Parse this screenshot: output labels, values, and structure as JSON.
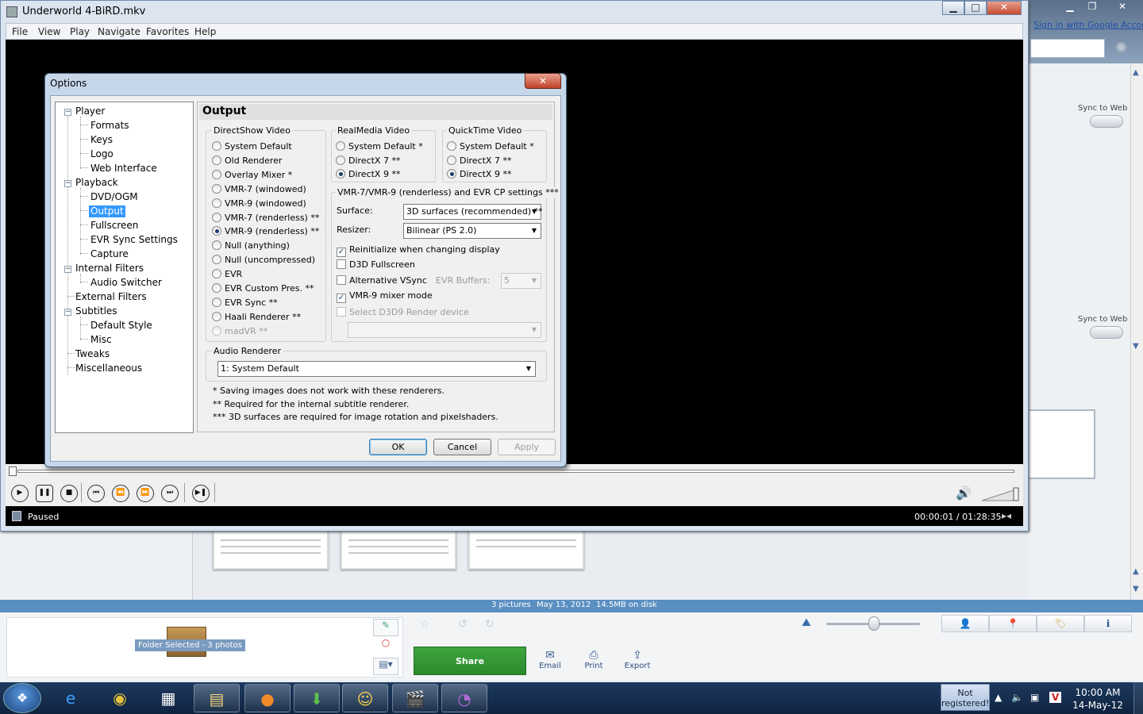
{
  "picasa": {
    "sign_in": "Sign in with Google Account",
    "sync_label": "Sync to Web",
    "info": {
      "pictures": "3 pictures",
      "date": "May 13, 2012",
      "size": "14.5MB on disk"
    },
    "folder_label": "Folder Selected - 3 photos",
    "share": "Share",
    "actions": {
      "email": "Email",
      "print": "Print",
      "export": "Export"
    }
  },
  "mpc": {
    "title": "Underworld 4-BiRD.mkv",
    "menu": [
      "File",
      "View",
      "Play",
      "Navigate",
      "Favorites",
      "Help"
    ],
    "status": "Paused",
    "time": "00:00:01 / 01:28:35"
  },
  "dialog": {
    "title": "Options",
    "panel_title": "Output",
    "tree": [
      {
        "label": "Player",
        "children": [
          "Formats",
          "Keys",
          "Logo",
          "Web Interface"
        ]
      },
      {
        "label": "Playback",
        "children": [
          "DVD/OGM",
          "Output",
          "Fullscreen",
          "EVR Sync Settings",
          "Capture"
        ]
      },
      {
        "label": "Internal Filters",
        "children": [
          "Audio Switcher"
        ]
      },
      {
        "label": "External Filters",
        "children": []
      },
      {
        "label": "Subtitles",
        "children": [
          "Default Style",
          "Misc"
        ]
      },
      {
        "label": "Tweaks",
        "children": []
      },
      {
        "label": "Miscellaneous",
        "children": []
      }
    ],
    "selected": "Output",
    "directshow": {
      "label": "DirectShow Video",
      "options": [
        "System Default",
        "Old Renderer",
        "Overlay Mixer *",
        "VMR-7 (windowed)",
        "VMR-9 (windowed)",
        "VMR-7 (renderless) **",
        "VMR-9 (renderless) **",
        "Null (anything)",
        "Null (uncompressed)",
        "EVR",
        "EVR Custom Pres. **",
        "EVR Sync **",
        "Haali Renderer **",
        "madVR **"
      ],
      "selected": "VMR-9 (renderless) **"
    },
    "realmedia": {
      "label": "RealMedia Video",
      "options": [
        "System Default *",
        "DirectX 7 **",
        "DirectX 9 **"
      ],
      "selected": "DirectX 9 **"
    },
    "quicktime": {
      "label": "QuickTime Video",
      "options": [
        "System Default *",
        "DirectX 7 **",
        "DirectX 9 **"
      ],
      "selected": "DirectX 9 **"
    },
    "vmr": {
      "label": "VMR-7/VMR-9 (renderless) and EVR CP settings ***",
      "surface_label": "Surface:",
      "surface_value": "3D surfaces (recommended) **",
      "resizer_label": "Resizer:",
      "resizer_value": "Bilinear (PS 2.0)",
      "reinit": "Reinitialize when changing display",
      "d3d": "D3D Fullscreen",
      "altvsync": "Alternative VSync",
      "evr_buffers_label": "EVR Buffers:",
      "evr_buffers_value": "5",
      "mixer": "VMR-9 mixer mode",
      "d3d9": "Select D3D9 Render device"
    },
    "audio": {
      "label": "Audio Renderer",
      "value": "1: System Default"
    },
    "notes": [
      "* Saving images does not work with these renderers.",
      "** Required for the internal subtitle renderer.",
      "*** 3D surfaces are required for image rotation and pixelshaders."
    ],
    "buttons": {
      "ok": "OK",
      "cancel": "Cancel",
      "apply": "Apply"
    }
  },
  "taskbar": {
    "not_registered": "Not registered!",
    "time": "10:00 AM",
    "date": "14-May-12"
  }
}
